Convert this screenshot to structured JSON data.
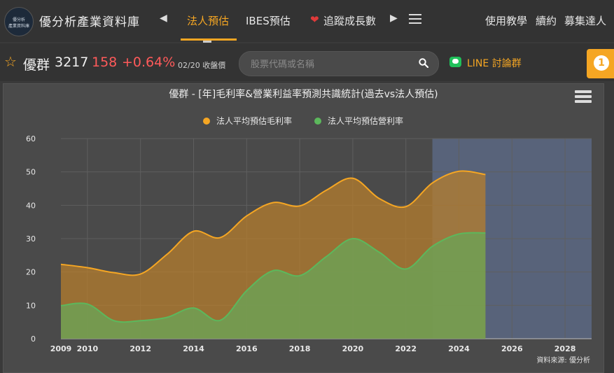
{
  "header": {
    "site_title": "優分析產業資料庫",
    "logo_line1": "優分析",
    "logo_line2": "產業資料庫",
    "nav_prev_icon": "triangle-left-icon",
    "nav_next_icon": "triangle-right-icon",
    "nav": [
      {
        "label": "法人預估",
        "active": true
      },
      {
        "label": "IBES預估",
        "active": false
      },
      {
        "label": "追蹤成長數",
        "active": false,
        "icon": "heart-icon"
      }
    ],
    "right_links": [
      "使用教學",
      "續約",
      "募集達人"
    ]
  },
  "quote": {
    "name": "優群",
    "code": "3217",
    "price": "158",
    "change": "+0.64%",
    "date": "02/20 收盤價",
    "search_placeholder": "股票代碼或名稱",
    "line_label": "LINE 討論群",
    "badge": "1"
  },
  "colors": {
    "accent": "#f5a623",
    "up": "#ff5a5a",
    "green": "#5cb85c"
  },
  "chart_data": {
    "type": "area",
    "title": "優群 - [年]毛利率&營業利益率預測共識統計(過去vs法人預估)",
    "xlabel": "",
    "ylabel": "",
    "ylim": [
      0,
      60
    ],
    "xlim": [
      2009,
      2029
    ],
    "yticks": [
      0,
      10,
      20,
      30,
      40,
      50,
      60
    ],
    "xticks": [
      2009,
      2010,
      2012,
      2014,
      2016,
      2018,
      2020,
      2022,
      2024,
      2026,
      2028
    ],
    "forecast_band": [
      2023,
      2029
    ],
    "grid": true,
    "legend_position": "top-center",
    "source_note": "資料來源: 優分析",
    "series": [
      {
        "name": "法人平均預估毛利率",
        "color": "#f5a623",
        "x": [
          2009,
          2010,
          2011,
          2012,
          2013,
          2014,
          2015,
          2016,
          2017,
          2018,
          2019,
          2020,
          2021,
          2022,
          2023,
          2024,
          2025
        ],
        "values": [
          22.3,
          21.3,
          19.8,
          19.4,
          25.3,
          32.2,
          30.3,
          36.8,
          40.8,
          39.8,
          44.5,
          48.1,
          42.0,
          39.6,
          46.7,
          50.2,
          49.2
        ]
      },
      {
        "name": "法人平均預估營利率",
        "color": "#5cb85c",
        "x": [
          2009,
          2010,
          2011,
          2012,
          2013,
          2014,
          2015,
          2016,
          2017,
          2018,
          2019,
          2020,
          2021,
          2022,
          2023,
          2024,
          2025
        ],
        "values": [
          9.9,
          10.4,
          5.4,
          5.4,
          6.4,
          9.2,
          5.5,
          14.4,
          20.4,
          18.9,
          24.6,
          30.0,
          25.9,
          20.9,
          27.7,
          31.4,
          31.7
        ]
      }
    ]
  }
}
